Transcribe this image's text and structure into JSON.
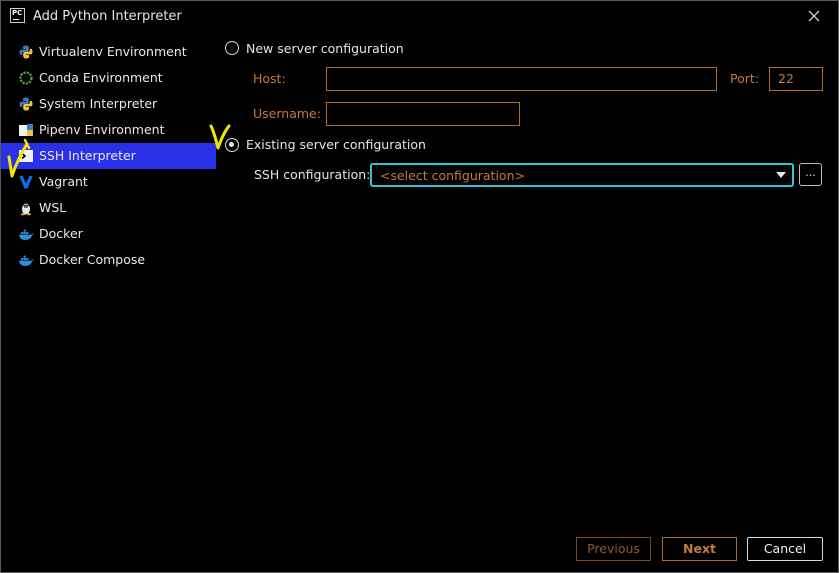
{
  "window": {
    "title": "Add Python Interpreter",
    "logo_text": "PC"
  },
  "sidebar": {
    "items": [
      {
        "label": "Virtualenv Environment",
        "icon": "python-icon"
      },
      {
        "label": "Conda Environment",
        "icon": "conda-icon"
      },
      {
        "label": "System Interpreter",
        "icon": "python-icon"
      },
      {
        "label": "Pipenv Environment",
        "icon": "pipenv-icon"
      },
      {
        "label": "SSH Interpreter",
        "icon": "ssh-icon",
        "selected": true
      },
      {
        "label": "Vagrant",
        "icon": "vagrant-icon"
      },
      {
        "label": "WSL",
        "icon": "linux-icon"
      },
      {
        "label": "Docker",
        "icon": "docker-icon"
      },
      {
        "label": "Docker Compose",
        "icon": "docker-icon"
      }
    ]
  },
  "main": {
    "new_server_label": "New server configuration",
    "host_label": "Host:",
    "host_value": "",
    "port_label": "Port:",
    "port_value": "22",
    "username_label": "Username:",
    "username_value": "",
    "existing_server_label": "Existing server configuration",
    "ssh_config_label": "SSH configuration:",
    "ssh_config_value": "<select configuration>",
    "browse_label": "..."
  },
  "buttons": {
    "previous": "Previous",
    "next": "Next",
    "cancel": "Cancel"
  },
  "colors": {
    "selection": "#2a2fe8",
    "focus_ring": "#2fc6da",
    "disabled_text": "#c47a3a",
    "annotation": "#f2e600"
  }
}
